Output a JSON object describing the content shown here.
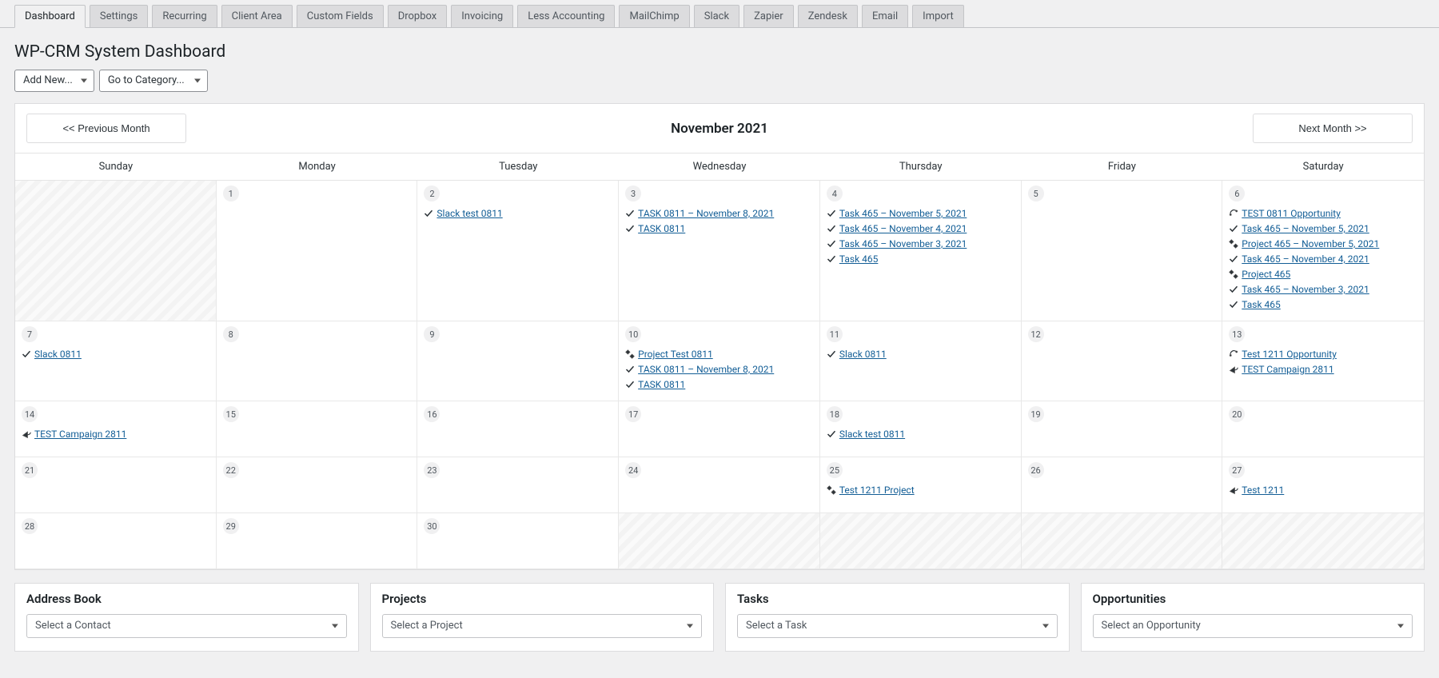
{
  "tabs": [
    "Dashboard",
    "Settings",
    "Recurring",
    "Client Area",
    "Custom Fields",
    "Dropbox",
    "Invoicing",
    "Less Accounting",
    "MailChimp",
    "Slack",
    "Zapier",
    "Zendesk",
    "Email",
    "Import"
  ],
  "active_tab": 0,
  "page_title": "WP-CRM System Dashboard",
  "toolbar": {
    "add_new": "Add New...",
    "go_to_category": "Go to Category..."
  },
  "calendar": {
    "prev": "<< Previous Month",
    "next": "Next Month >>",
    "title": "November 2021",
    "day_headers": [
      "Sunday",
      "Monday",
      "Tuesday",
      "Wednesday",
      "Thursday",
      "Friday",
      "Saturday"
    ],
    "weeks": [
      [
        {
          "outside": true
        },
        {
          "day": "1"
        },
        {
          "day": "2",
          "events": [
            {
              "type": "task",
              "label": "Slack test 0811"
            }
          ]
        },
        {
          "day": "3",
          "events": [
            {
              "type": "task",
              "label": "TASK 0811 – November 8, 2021"
            },
            {
              "type": "task",
              "label": "TASK 0811"
            }
          ]
        },
        {
          "day": "4",
          "events": [
            {
              "type": "task",
              "label": "Task 465 – November 5, 2021"
            },
            {
              "type": "task",
              "label": "Task 465 – November 4, 2021"
            },
            {
              "type": "task",
              "label": "Task 465 – November 3, 2021"
            },
            {
              "type": "task",
              "label": "Task 465"
            }
          ]
        },
        {
          "day": "5"
        },
        {
          "day": "6",
          "events": [
            {
              "type": "opportunity",
              "label": "TEST 0811 Opportunity"
            },
            {
              "type": "task",
              "label": "Task 465 – November 5, 2021"
            },
            {
              "type": "project",
              "label": "Project 465 – November 5, 2021"
            },
            {
              "type": "task",
              "label": "Task 465 – November 4, 2021"
            },
            {
              "type": "project",
              "label": "Project 465"
            },
            {
              "type": "task",
              "label": "Task 465 – November 3, 2021"
            },
            {
              "type": "task",
              "label": "Task 465"
            }
          ]
        }
      ],
      [
        {
          "day": "7",
          "events": [
            {
              "type": "task",
              "label": "Slack 0811"
            }
          ]
        },
        {
          "day": "8"
        },
        {
          "day": "9"
        },
        {
          "day": "10",
          "events": [
            {
              "type": "project",
              "label": "Project Test 0811"
            },
            {
              "type": "task",
              "label": "TASK 0811 – November 8, 2021"
            },
            {
              "type": "task",
              "label": "TASK 0811"
            }
          ]
        },
        {
          "day": "11",
          "events": [
            {
              "type": "task",
              "label": "Slack 0811"
            }
          ]
        },
        {
          "day": "12"
        },
        {
          "day": "13",
          "events": [
            {
              "type": "opportunity",
              "label": "Test 1211 Opportunity"
            },
            {
              "type": "campaign",
              "label": "TEST Campaign 2811"
            }
          ]
        }
      ],
      [
        {
          "day": "14",
          "events": [
            {
              "type": "campaign",
              "label": "TEST Campaign 2811"
            }
          ]
        },
        {
          "day": "15"
        },
        {
          "day": "16"
        },
        {
          "day": "17"
        },
        {
          "day": "18",
          "events": [
            {
              "type": "task",
              "label": "Slack test 0811"
            }
          ]
        },
        {
          "day": "19"
        },
        {
          "day": "20"
        }
      ],
      [
        {
          "day": "21"
        },
        {
          "day": "22"
        },
        {
          "day": "23"
        },
        {
          "day": "24"
        },
        {
          "day": "25",
          "events": [
            {
              "type": "project",
              "label": "Test 1211 Project"
            }
          ]
        },
        {
          "day": "26"
        },
        {
          "day": "27",
          "events": [
            {
              "type": "campaign",
              "label": "Test 1211"
            }
          ]
        }
      ],
      [
        {
          "day": "28"
        },
        {
          "day": "29"
        },
        {
          "day": "30"
        },
        {
          "outside": true
        },
        {
          "outside": true
        },
        {
          "outside": true
        },
        {
          "outside": true
        }
      ]
    ]
  },
  "panels": {
    "address_book": {
      "title": "Address Book",
      "select": "Select a Contact"
    },
    "projects": {
      "title": "Projects",
      "select": "Select a Project"
    },
    "tasks": {
      "title": "Tasks",
      "select": "Select a Task"
    },
    "opportunities": {
      "title": "Opportunities",
      "select": "Select an Opportunity"
    }
  }
}
